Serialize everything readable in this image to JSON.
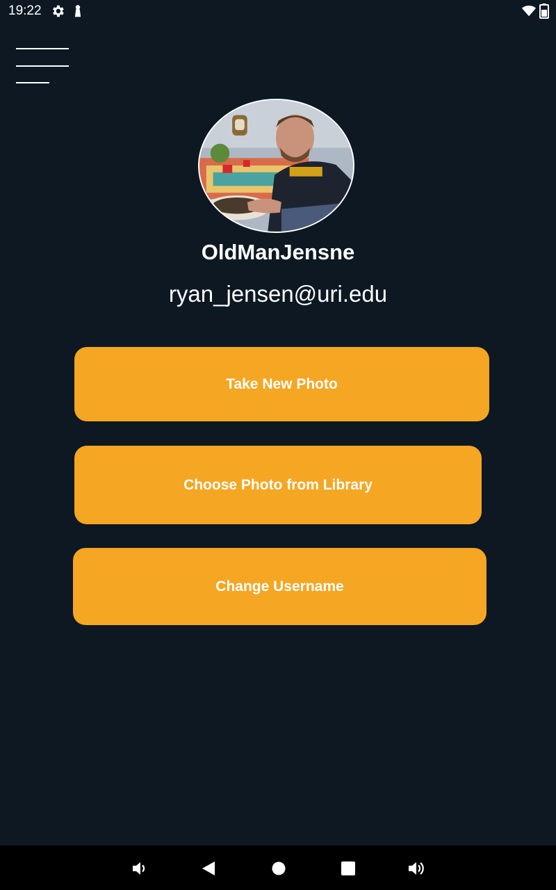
{
  "status_bar": {
    "time": "19:22",
    "icons": [
      "gear-icon",
      "lock-icon",
      "wifi-icon",
      "battery-icon"
    ]
  },
  "menu": {
    "icon": "hamburger-menu-icon"
  },
  "profile": {
    "username": "OldManJensne",
    "email": "ryan_jensen@uri.edu",
    "avatar": "profile-photo"
  },
  "actions": {
    "take_photo": "Take New Photo",
    "choose_photo": "Choose Photo from Library",
    "change_username": "Change Username"
  },
  "nav_bar": {
    "icons": [
      "volume-down-icon",
      "back-icon",
      "home-icon",
      "recents-icon",
      "volume-up-icon"
    ]
  },
  "colors": {
    "background": "#0d1822",
    "accent": "#f5a623",
    "text": "#ffffff",
    "nav_background": "#000000"
  }
}
